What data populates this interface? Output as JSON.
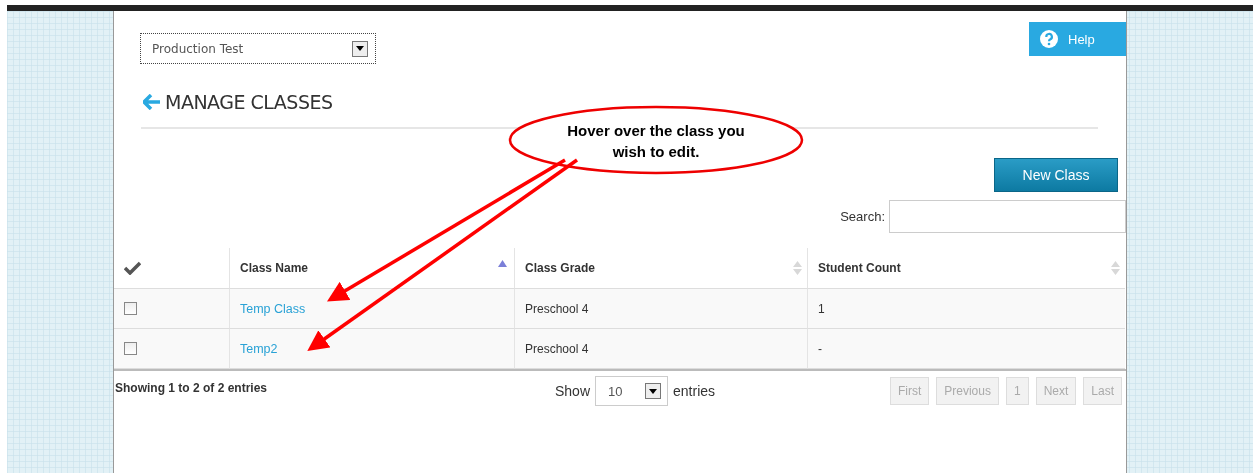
{
  "account_select": {
    "value": "Production Test"
  },
  "help_button": {
    "label": "Help"
  },
  "page_title": "MANAGE CLASSES",
  "new_class_button": {
    "label": "New Class"
  },
  "search": {
    "label": "Search:"
  },
  "table": {
    "columns": [
      {
        "kind": "check"
      },
      {
        "kind": "text",
        "label": "Class Name",
        "sorted": true
      },
      {
        "kind": "text",
        "label": "Class Grade",
        "sorted": false
      },
      {
        "kind": "text",
        "label": "Student Count",
        "sorted": false
      }
    ],
    "rows": [
      {
        "checked": false,
        "class_name": "Temp Class",
        "class_grade": "Preschool 4",
        "student_count": "1"
      },
      {
        "checked": false,
        "class_name": "Temp2",
        "class_grade": "Preschool 4",
        "student_count": "-"
      }
    ]
  },
  "footer": {
    "info": "Showing 1 to 2 of 2 entries",
    "length": {
      "prefix": "Show",
      "value": "10",
      "suffix": "entries"
    },
    "pagination": [
      {
        "label": "First",
        "disabled": true
      },
      {
        "label": "Previous",
        "disabled": true
      },
      {
        "label": "1",
        "disabled": true
      },
      {
        "label": "Next",
        "disabled": true
      },
      {
        "label": "Last",
        "disabled": true
      }
    ]
  },
  "annotation": {
    "text": "Hover over the class you wish to edit."
  }
}
